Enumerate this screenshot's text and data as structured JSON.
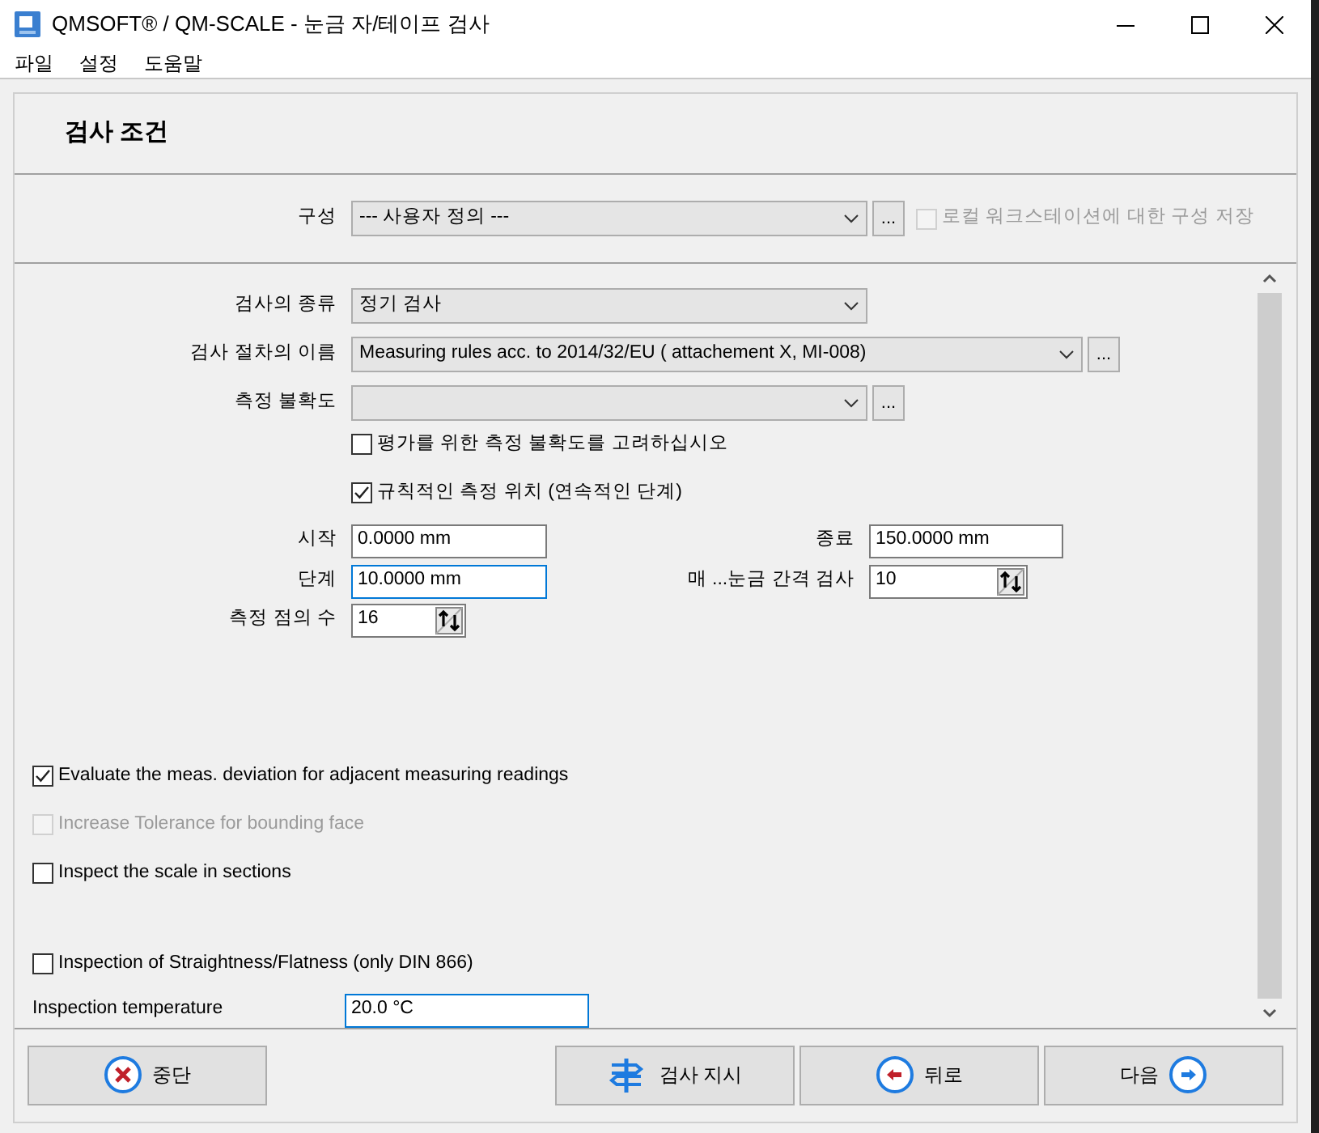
{
  "window": {
    "title": "QMSOFT® / QM-SCALE - 눈금 자/테이프 검사"
  },
  "menu": [
    "파일",
    "설정",
    "도움말"
  ],
  "section_title": "검사 조건",
  "configuration": {
    "label": "구성",
    "value": "--- 사용자 정의 ---",
    "button": "...",
    "save_option": {
      "label": "로컬 워크스테이션에 대한 구성 저장",
      "checked": false,
      "disabled": true
    }
  },
  "inspection_type": {
    "label": "검사의 종류",
    "value": "정기 검사"
  },
  "procedure": {
    "label": "검사 절차의 이름",
    "value": "Measuring rules acc. to 2014/32/EU ( attachement X, MI-008)",
    "button": "..."
  },
  "uncertainty": {
    "label": "측정 불확도",
    "button": "..."
  },
  "uncertainty_options": [
    {
      "label": "평가를 위한 측정 불확도를 고려하십시오",
      "checked": false
    },
    {
      "label": "규칙적인 측정 위치 (연속적인 단계)",
      "checked": true
    }
  ],
  "start": {
    "label": "시작",
    "value": "0.0000 mm"
  },
  "end": {
    "label": "종료",
    "value": "150.0000 mm"
  },
  "step": {
    "label": "단계",
    "value": "10.0000 mm",
    "focused": true
  },
  "every_nth": {
    "label": "매 ...눈금 간격 검사",
    "value": "10"
  },
  "point_count": {
    "label": "측정 점의 수",
    "value": "16"
  },
  "options": [
    {
      "label": "Evaluate the meas. deviation for adjacent measuring readings",
      "checked": true,
      "disabled": false
    },
    {
      "label": "Increase Tolerance for bounding face",
      "checked": false,
      "disabled": true
    },
    {
      "label": "Inspect the scale in sections",
      "checked": false,
      "disabled": false
    },
    {
      "label": "Inspection of Straightness/Flatness (only DIN 866)",
      "checked": false,
      "disabled": false
    }
  ],
  "temperature": {
    "label": "Inspection temperature",
    "value": "20.0 °C"
  },
  "buttons": [
    {
      "kind": "cancel",
      "label": "중단"
    },
    {
      "kind": "instruction",
      "label": "검사 지시"
    },
    {
      "kind": "back",
      "label": "뒤로"
    },
    {
      "kind": "next",
      "label": "다음"
    }
  ]
}
